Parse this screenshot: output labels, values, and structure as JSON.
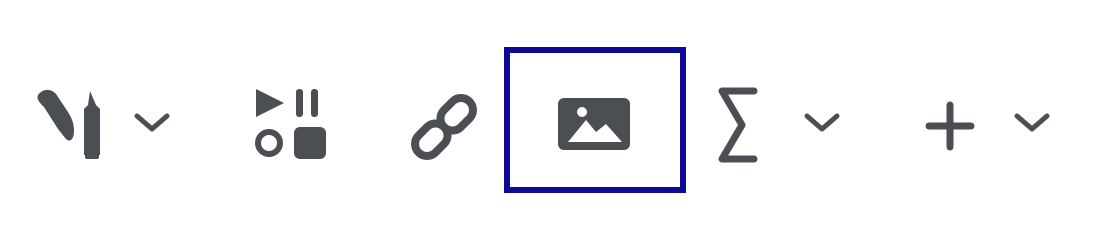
{
  "toolbar": {
    "icon_color": "#4b4e53",
    "focus_color": "#0c0a96",
    "buttons": [
      {
        "id": "style",
        "icon": "brush-pencil-icon",
        "has_dropdown": true
      },
      {
        "id": "media",
        "icon": "media-play-pause-shapes-icon",
        "has_dropdown": false
      },
      {
        "id": "link",
        "icon": "link-icon",
        "has_dropdown": false
      },
      {
        "id": "image",
        "icon": "image-icon",
        "has_dropdown": false,
        "focused": true
      },
      {
        "id": "formula",
        "icon": "sigma-icon",
        "has_dropdown": true
      },
      {
        "id": "insert",
        "icon": "plus-icon",
        "has_dropdown": true
      }
    ]
  }
}
